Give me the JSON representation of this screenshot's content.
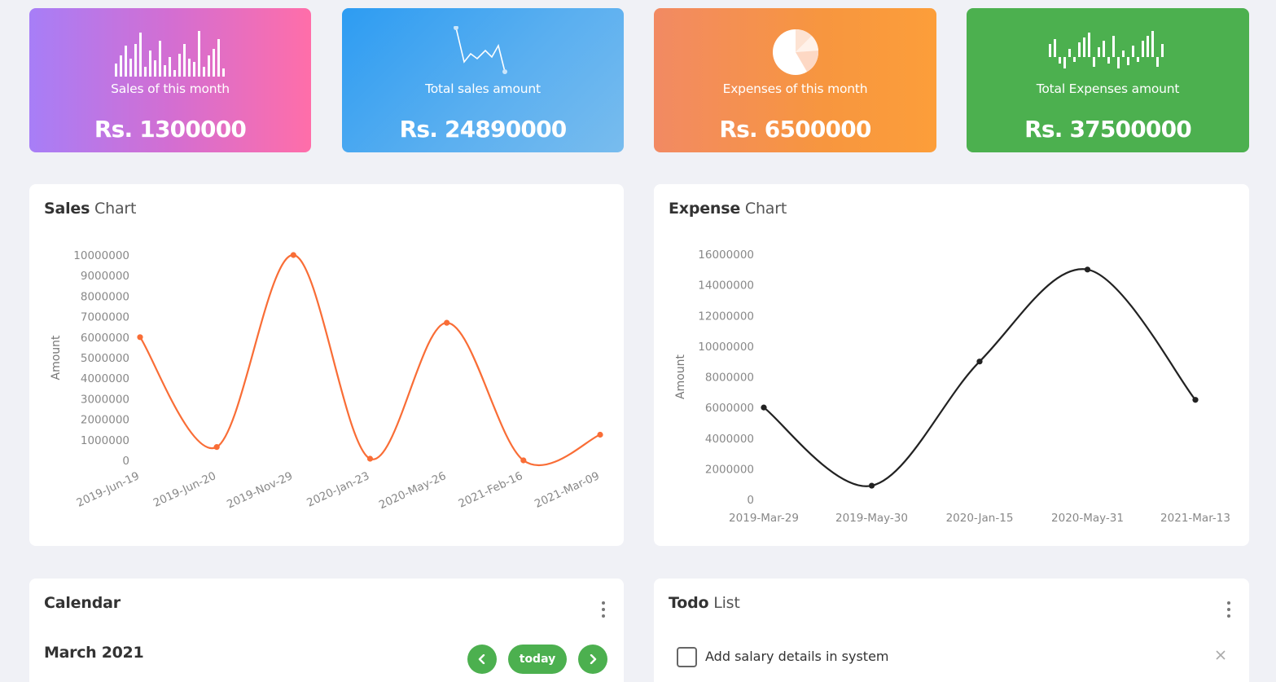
{
  "stats": [
    {
      "id": "card1",
      "label": "Sales of this month",
      "value": "Rs. 1300000",
      "icon": "bar-sparkline-icon"
    },
    {
      "id": "card2",
      "label": "Total sales amount",
      "value": "Rs. 24890000",
      "icon": "line-sparkline-icon"
    },
    {
      "id": "card3",
      "label": "Expenses of this month",
      "value": "Rs. 6500000",
      "icon": "pie-sparkline-icon"
    },
    {
      "id": "card4",
      "label": "Total Expenses amount",
      "value": "Rs. 37500000",
      "icon": "win-loss-sparkline-icon"
    }
  ],
  "sales_panel": {
    "title_bold": "Sales",
    "title_rest": " Chart"
  },
  "expense_panel": {
    "title_bold": "Expense",
    "title_rest": " Chart"
  },
  "chart_data": [
    {
      "type": "line",
      "title": "Sales Chart",
      "xlabel": "",
      "ylabel": "Amount",
      "ylim": [
        0,
        10000000
      ],
      "yticks": [
        0,
        1000000,
        2000000,
        3000000,
        4000000,
        5000000,
        6000000,
        7000000,
        8000000,
        9000000,
        10000000
      ],
      "x": [
        "2019-Jun-19",
        "2019-Jun-20",
        "2019-Nov-29",
        "2020-Jan-23",
        "2020-May-26",
        "2021-Feb-16",
        "2021-Mar-09"
      ],
      "series": [
        {
          "values": [
            6000000,
            650000,
            10000000,
            80000,
            6700000,
            0,
            1250000
          ],
          "color": "#f96d36"
        }
      ],
      "grid": false,
      "smooth": true
    },
    {
      "type": "line",
      "title": "Expense Chart",
      "xlabel": "",
      "ylabel": "Amount",
      "ylim": [
        0,
        16000000
      ],
      "yticks": [
        0,
        2000000,
        4000000,
        6000000,
        8000000,
        10000000,
        12000000,
        14000000,
        16000000
      ],
      "x": [
        "2019-Mar-29",
        "2019-May-30",
        "2020-Jan-15",
        "2020-May-31",
        "2021-Mar-13"
      ],
      "series": [
        {
          "values": [
            6000000,
            900000,
            9000000,
            15000000,
            6500000
          ],
          "color": "#222222"
        }
      ],
      "grid": false,
      "smooth": true
    }
  ],
  "calendar": {
    "title": "Calendar",
    "month": "March 2021",
    "prev_label": "‹",
    "today_label": "today",
    "next_label": "›"
  },
  "todo": {
    "title_bold": "Todo",
    "title_rest": " List",
    "items": [
      {
        "text": "Add salary details in system",
        "done": false
      }
    ]
  },
  "colors": {
    "green": "#4cb04f",
    "sales_line": "#f96d36",
    "expense_line": "#222222"
  }
}
